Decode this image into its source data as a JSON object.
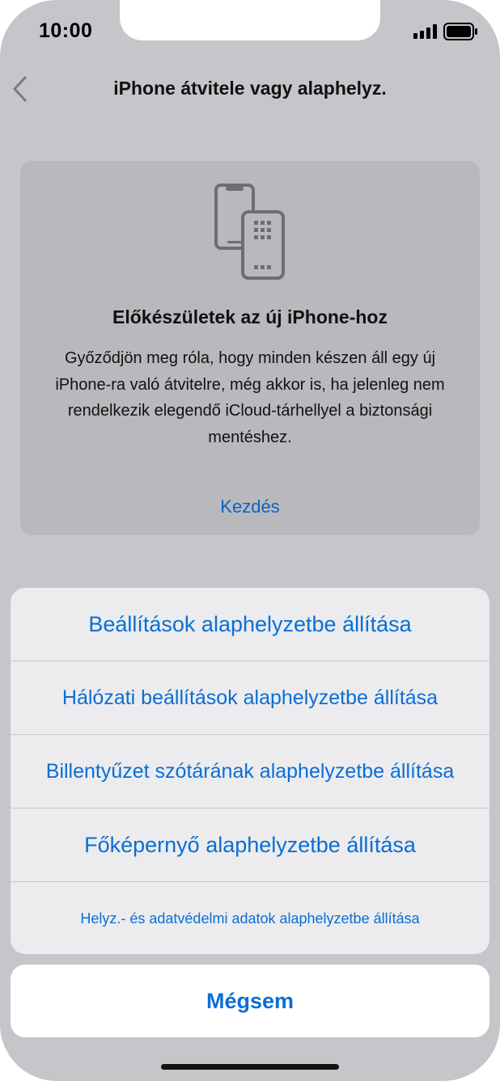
{
  "status_bar": {
    "time": "10:00"
  },
  "nav": {
    "title": "iPhone átvitele vagy alaphelyz.",
    "back_icon": "chevron-left-icon"
  },
  "card": {
    "icon": "phone-transfer-icon",
    "heading": "Előkészületek az új iPhone-hoz",
    "body": "Győződjön meg róla, hogy minden készen áll egy új iPhone-ra való átvitelre, még akkor is, ha jelenleg nem rendelkezik elegendő iCloud-tárhellyel a biztonsági mentéshez.",
    "link": "Kezdés"
  },
  "action_sheet": {
    "options": [
      "Beállítások alaphelyzetbe állítása",
      "Hálózati beállítások alaphelyzetbe állítása",
      "Billentyűzet szótárának alaphelyzetbe állítása",
      "Főképernyő alaphelyzetbe állítása",
      "Helyz.- és adatvédelmi adatok alaphelyzetbe állítása"
    ],
    "cancel": "Mégsem"
  },
  "colors": {
    "accent": "#0a6ed6",
    "dimmed_background": "#c5c5ca",
    "sheet_background": "#ececee"
  }
}
